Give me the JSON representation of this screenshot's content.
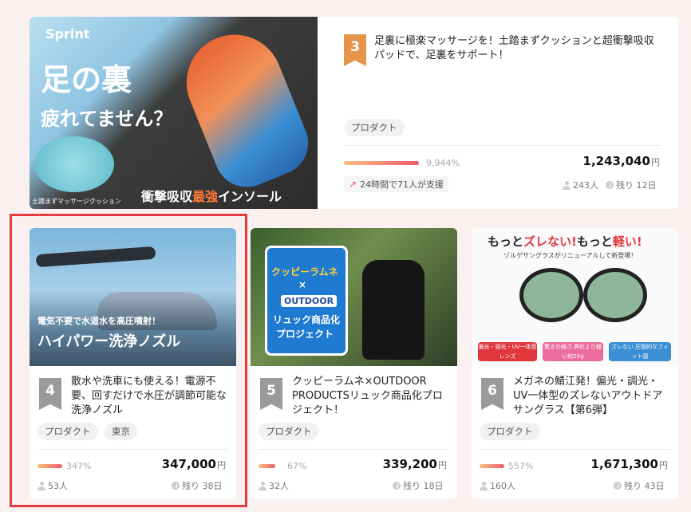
{
  "cards": [
    {
      "rank": "3",
      "image": {
        "brand": "Sprint",
        "headline1": "足の裏",
        "headline2": "疲れてません？",
        "caption_small": "土踏まずマッサージクッション",
        "caption_prefix": "衝撃吸収",
        "caption_accent": "最強",
        "caption_suffix": "インソール"
      },
      "title": "足裏に極楽マッサージを！土踏まずクッションと超衝撃吸収パッドで、足裏をサポート！",
      "tags": [
        "プロダクト"
      ],
      "percent": "9,944%",
      "percent_fraction": 1.0,
      "amount": "1,243,040",
      "yen": "円",
      "trend": "24時間で71人が支援",
      "supporters": "243人",
      "remaining": "残り 12日"
    },
    {
      "rank": "4",
      "image": {
        "line1": "電気不要で水道水を高圧噴射！",
        "line2": "ハイパワー洗浄ノズル"
      },
      "title": "散水や洗車にも使える！電源不要、回すだけで水圧が調節可能な洗浄ノズル",
      "tags": [
        "プロダクト",
        "東京"
      ],
      "percent": "347%",
      "percent_fraction": 1.0,
      "amount": "347,000",
      "yen": "円",
      "supporters": "53人",
      "remaining": "残り 38日"
    },
    {
      "rank": "5",
      "image": {
        "brand": "クッピーラムネ",
        "times": "×",
        "brand2": "OUTDOOR",
        "line1": "リュック商品化",
        "line2": "プロジェクト"
      },
      "title": "クッピーラムネ×OUTDOOR PRODUCTSリュック商品化プロジェクト！",
      "tags": [
        "プロダクト"
      ],
      "percent": "67%",
      "percent_fraction": 0.67,
      "amount": "339,200",
      "yen": "円",
      "supporters": "32人",
      "remaining": "残り 18日"
    },
    {
      "rank": "6",
      "image": {
        "headline_a": "もっと",
        "headline_b": "ズレない!",
        "headline_c": "もっと",
        "headline_d": "軽い!",
        "sub": "ゾルゲサングラスがリニューアルして新登場！",
        "feat1": "偏光・調光・UV一体型レンズ",
        "feat2": "驚きの軽さ 弊社より軽い約20g",
        "feat3": "ズレない 圧倒的なフィット感"
      },
      "title": "メガネの鯖江発！偏光・調光・UV一体型のズレないアウトドアサングラス【第6弾】",
      "tags": [
        "プロダクト"
      ],
      "percent": "557%",
      "percent_fraction": 1.0,
      "amount": "1,671,300",
      "yen": "円",
      "supporters": "160人",
      "remaining": "残り 43日"
    }
  ],
  "colors": {
    "highlight": "#e53d3d",
    "rank_top": "#e6944a",
    "rank_other": "#9a9a9a",
    "progress_start": "#f8c07a",
    "progress_end": "#ef5b70"
  }
}
